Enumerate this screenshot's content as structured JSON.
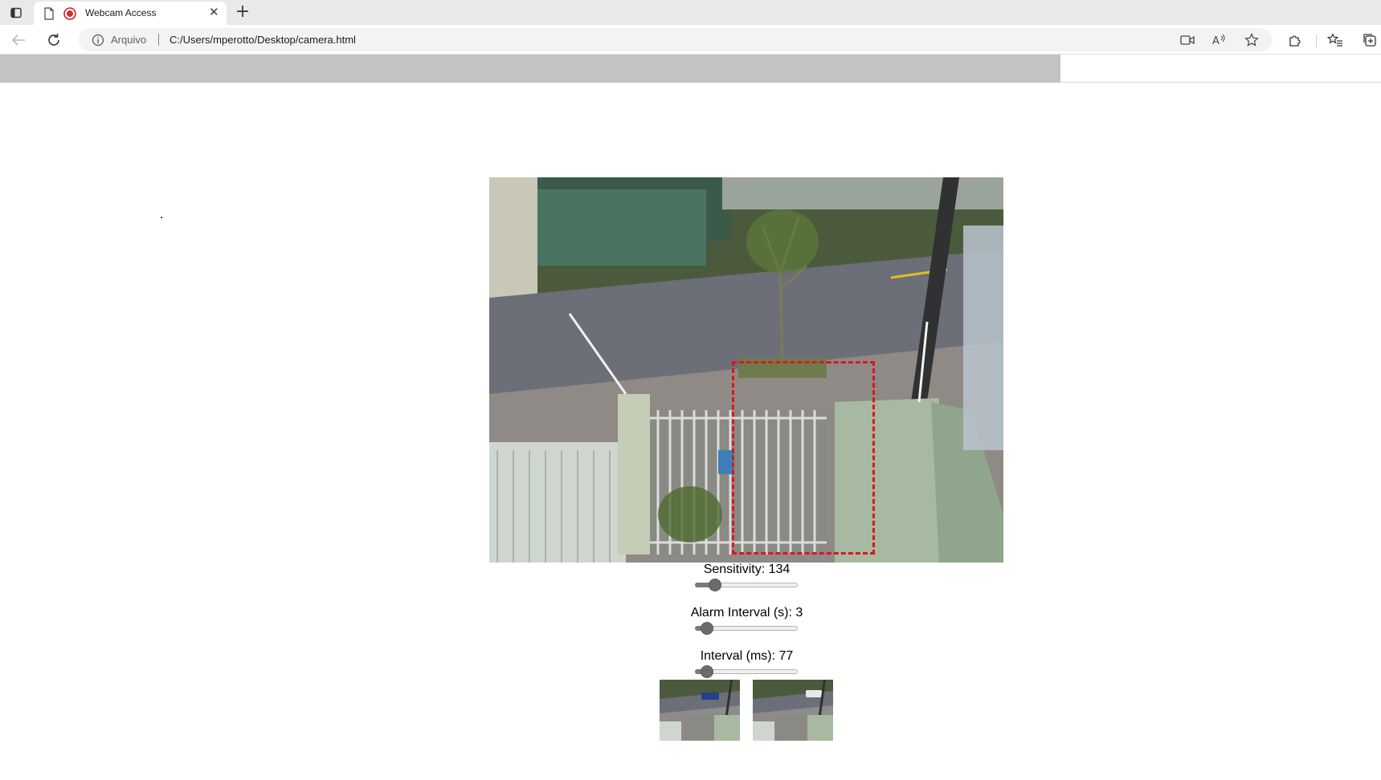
{
  "browser": {
    "tab": {
      "title": "Webcam Access"
    },
    "new_tab_symbol": "+",
    "address": {
      "scheme_label": "Arquivo",
      "url": "C:/Users/mperotto/Desktop/camera.html"
    },
    "icons": [
      "sidebar-toggle-icon",
      "page-icon",
      "recording-icon",
      "close-icon",
      "back-icon",
      "reload-icon",
      "info-icon",
      "camera-in-use-icon",
      "read-aloud-icon",
      "favorite-star-icon",
      "extensions-icon",
      "favorites-icon",
      "collections-icon"
    ]
  },
  "page": {
    "controls": {
      "sensitivity": {
        "label": "Sensitivity: 134",
        "value": 134,
        "fraction": 0.15
      },
      "alarm_interval": {
        "label": "Alarm Interval (s): 3",
        "value": 3,
        "fraction": 0.06
      },
      "interval": {
        "label": "Interval (ms): 77",
        "value": 77,
        "fraction": 0.06
      }
    },
    "motion_box_color": "#e0141e",
    "snapshots": [
      "snapshot-1",
      "snapshot-2"
    ]
  }
}
